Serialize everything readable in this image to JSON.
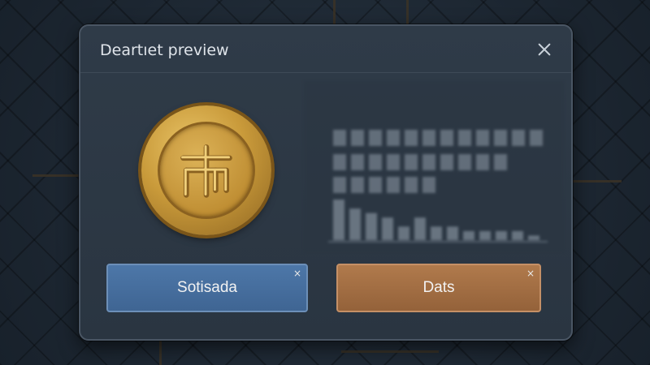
{
  "dialog": {
    "title": "Deartıet preview",
    "close_icon": "close-icon"
  },
  "coin": {
    "icon": "coin-emblem-icon",
    "colors": {
      "gold": "#c99a3a",
      "rim": "#7a5519"
    }
  },
  "buttons": {
    "left_label": "Sotisada",
    "right_label": "Dats",
    "left_color": "#4d77a8",
    "right_color": "#b07a4c",
    "dismiss_glyph": "×"
  },
  "blurred_background_content": {
    "type": "bar",
    "values": [
      9,
      7,
      6,
      5,
      3,
      5,
      3,
      3,
      2,
      2,
      2,
      2,
      1
    ]
  }
}
